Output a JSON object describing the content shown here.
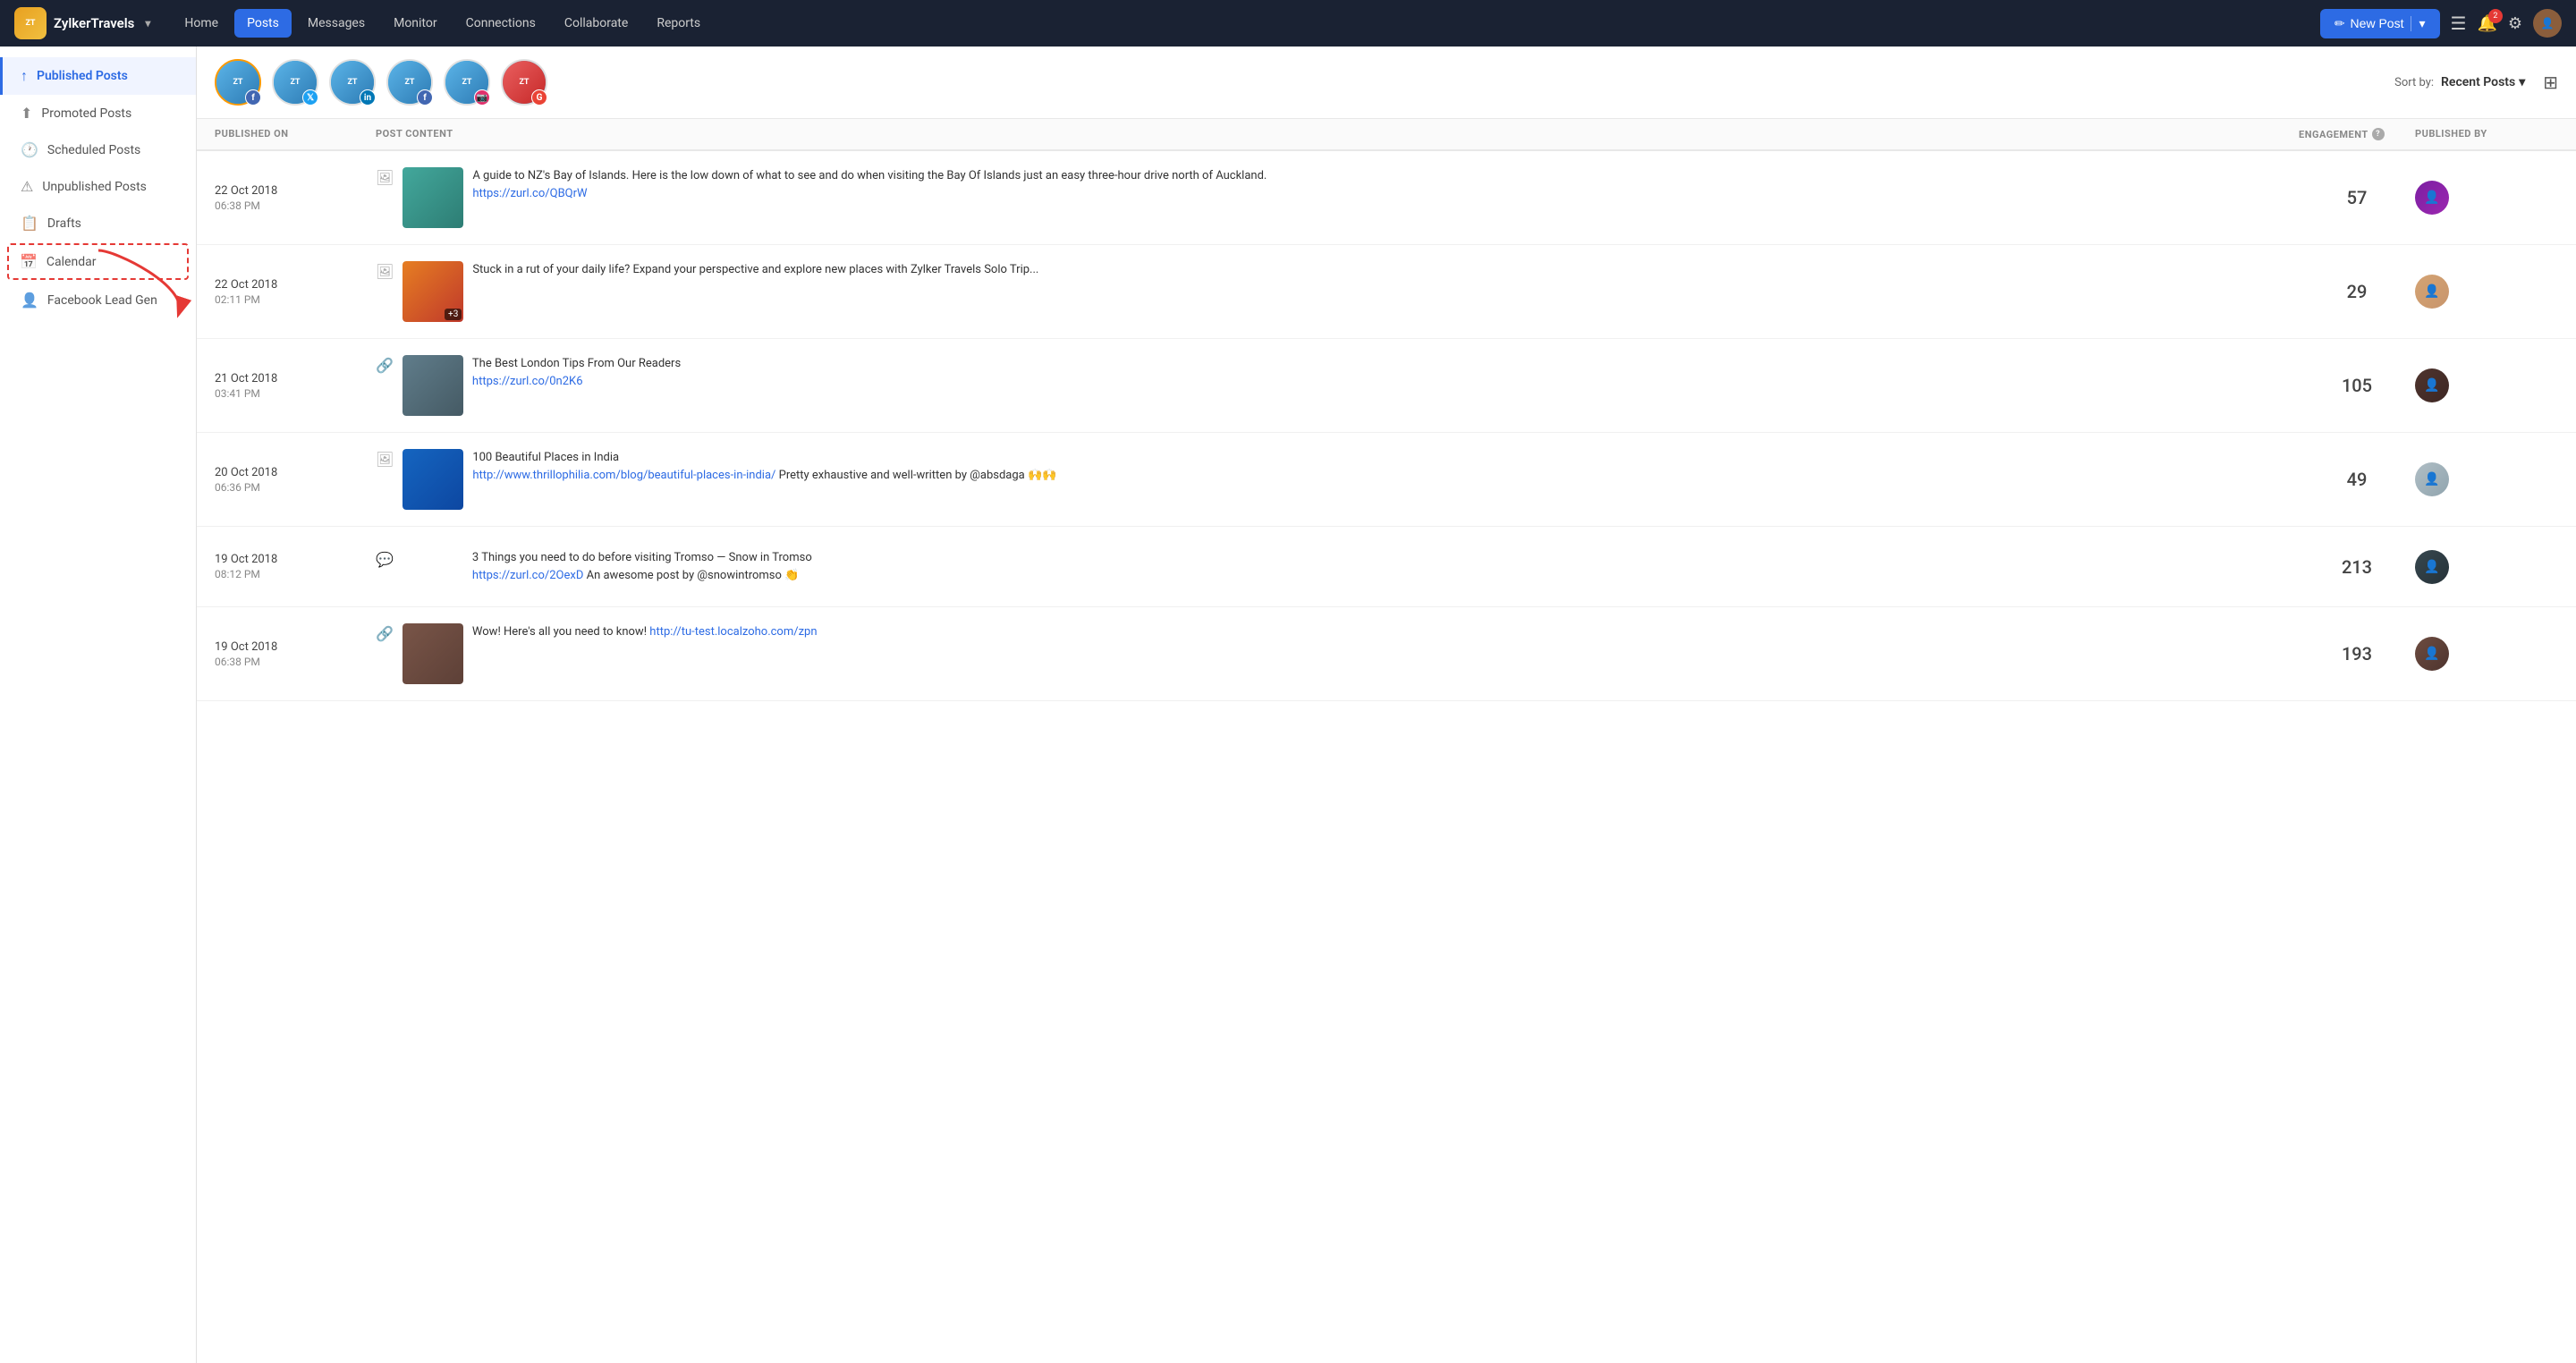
{
  "brand": {
    "name": "ZylkerTravels",
    "logo_text": "ZT"
  },
  "nav": {
    "items": [
      {
        "id": "home",
        "label": "Home",
        "active": false
      },
      {
        "id": "posts",
        "label": "Posts",
        "active": true
      },
      {
        "id": "messages",
        "label": "Messages",
        "active": false
      },
      {
        "id": "monitor",
        "label": "Monitor",
        "active": false
      },
      {
        "id": "connections",
        "label": "Connections",
        "active": false
      },
      {
        "id": "collaborate",
        "label": "Collaborate",
        "active": false
      },
      {
        "id": "reports",
        "label": "Reports",
        "active": false
      }
    ],
    "new_post_label": "New Post",
    "notification_count": "2"
  },
  "sidebar": {
    "items": [
      {
        "id": "published",
        "label": "Published Posts",
        "icon": "↑",
        "active": true
      },
      {
        "id": "promoted",
        "label": "Promoted Posts",
        "icon": "⬆",
        "active": false
      },
      {
        "id": "scheduled",
        "label": "Scheduled Posts",
        "icon": "🕐",
        "active": false
      },
      {
        "id": "unpublished",
        "label": "Unpublished Posts",
        "icon": "⚠",
        "active": false
      },
      {
        "id": "drafts",
        "label": "Drafts",
        "icon": "📋",
        "active": false
      },
      {
        "id": "calendar",
        "label": "Calendar",
        "icon": "📅",
        "active": false,
        "highlighted": true
      },
      {
        "id": "leadgen",
        "label": "Facebook Lead Gen",
        "icon": "👤",
        "active": false
      }
    ]
  },
  "channels": [
    {
      "id": "fb1",
      "platform": "fb",
      "label": "ZylkerTravel FB",
      "color": "#4267B2",
      "active": true
    },
    {
      "id": "tw1",
      "platform": "tw",
      "label": "ZylkerTravel Twitter",
      "color": "#1DA1F2"
    },
    {
      "id": "li1",
      "platform": "li",
      "label": "ZylkerTravel LinkedIn",
      "color": "#0077B5"
    },
    {
      "id": "fb2",
      "platform": "fb",
      "label": "ZylkerTravel FB2",
      "color": "#4267B2"
    },
    {
      "id": "ig1",
      "platform": "ig",
      "label": "ZylkerTravel Instagram",
      "color": "#E1306C"
    },
    {
      "id": "gm1",
      "platform": "gm",
      "label": "ZylkerTravel Google",
      "color": "#EA4335"
    }
  ],
  "sort": {
    "label": "Sort by:",
    "current": "Recent Posts",
    "chevron": "▾"
  },
  "table_headers": {
    "published_on": "PUBLISHED ON",
    "post_content": "POST CONTENT",
    "engagement": "ENGAGEMENT",
    "published_by": "PUBLISHED BY"
  },
  "posts": [
    {
      "id": 1,
      "date": "22 Oct 2018",
      "time": "06:38 PM",
      "type_icon": "🖼",
      "has_thumb": true,
      "thumb_class": "thumb-1",
      "text": "A guide to NZ's Bay of Islands. Here is the low down of what to see and do when visiting the Bay Of Islands just an easy three-hour drive north of Auckland.",
      "link": "https://zurl.co/QBQrW",
      "link_text": "https://zurl.co/QBQrW",
      "engagement": "57",
      "avatar_class": "av1"
    },
    {
      "id": 2,
      "date": "22 Oct 2018",
      "time": "02:11 PM",
      "type_icon": "🖼",
      "has_thumb": true,
      "thumb_class": "thumb-2",
      "thumb_badge": "+3",
      "text": "Stuck in a rut of your daily life? Expand your perspective and explore new places with Zylker Travels Solo Trip...",
      "link": null,
      "engagement": "29",
      "avatar_class": "av2"
    },
    {
      "id": 3,
      "date": "21 Oct 2018",
      "time": "03:41 PM",
      "type_icon": "🔗",
      "has_thumb": true,
      "thumb_class": "thumb-3",
      "text": "The Best London Tips From Our Readers",
      "link": "https://zurl.co/0n2K6",
      "link_text": "https://zurl.co/0n2K6",
      "engagement": "105",
      "avatar_class": "av3"
    },
    {
      "id": 4,
      "date": "20 Oct 2018",
      "time": "06:36 PM",
      "type_icon": "🖼",
      "has_thumb": true,
      "thumb_class": "thumb-4",
      "text": "100 Beautiful Places in India",
      "link": "http://www.thrillophilia.com/blog/beautiful-places-in-india/",
      "link_text": "http://www.thrillophilia.com/blog/beautiful-places-in-india/",
      "extra_text": " Pretty exhaustive and well-written by @absdaga 🙌🙌",
      "engagement": "49",
      "avatar_class": "av4"
    },
    {
      "id": 5,
      "date": "19 Oct 2018",
      "time": "08:12 PM",
      "type_icon": "💬",
      "has_thumb": false,
      "text": "3 Things you need to do before visiting Tromso — Snow in Tromso",
      "link": "https://zurl.co/2OexD",
      "link_text": "https://zurl.co/2OexD",
      "extra_text": " An awesome post by @snowintromso 👏",
      "engagement": "213",
      "avatar_class": "av5"
    },
    {
      "id": 6,
      "date": "19 Oct 2018",
      "time": "06:38 PM",
      "type_icon": "🔗",
      "has_thumb": true,
      "thumb_class": "thumb-7",
      "text": "Wow! Here's all you need to know!",
      "link": "http://tu-test.localzoho.com/zpn",
      "link_text": "http://tu-test.localzoho.com/zpn",
      "engagement": "193",
      "avatar_class": "av6"
    }
  ]
}
